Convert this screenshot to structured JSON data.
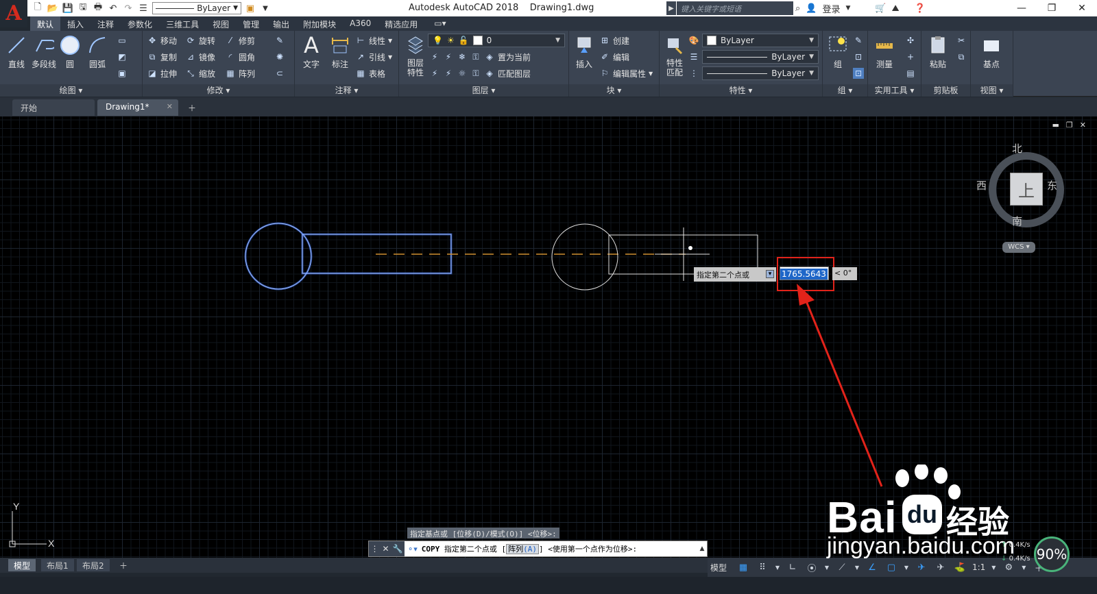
{
  "app": {
    "title": "Autodesk AutoCAD 2018",
    "document": "Drawing1.dwg",
    "logo_letter": "A"
  },
  "quick_access": {
    "layer_value": "ByLayer",
    "search_placeholder": "键入关键字或短语",
    "login_label": "登录"
  },
  "ribbon_tabs": [
    "默认",
    "插入",
    "注释",
    "参数化",
    "三维工具",
    "视图",
    "管理",
    "输出",
    "附加模块",
    "A360",
    "精选应用"
  ],
  "ribbon": {
    "draw": {
      "title": "绘图",
      "buttons": [
        "直线",
        "多段线",
        "圆",
        "圆弧"
      ]
    },
    "modify": {
      "title": "修改",
      "rows": [
        [
          "移动",
          "旋转",
          "修剪"
        ],
        [
          "复制",
          "镜像",
          "圆角"
        ],
        [
          "拉伸",
          "缩放",
          "阵列"
        ]
      ]
    },
    "annotation": {
      "title": "注释",
      "buttons": [
        "文字",
        "标注"
      ],
      "rows": [
        "线性",
        "引线",
        "表格"
      ]
    },
    "layers": {
      "title": "图层",
      "big_button": "图层\n特性",
      "layer_name": "0",
      "rows": [
        "置为当前",
        "匹配图层"
      ]
    },
    "block": {
      "title": "块",
      "big_button": "插入",
      "rows": [
        "创建",
        "编辑",
        "编辑属性"
      ]
    },
    "properties": {
      "title": "特性",
      "big_button": "特性\n匹配",
      "color": "ByLayer",
      "linetype": "ByLayer",
      "lineweight": "ByLayer"
    },
    "groups": {
      "title": "组",
      "big_button": "组"
    },
    "utilities": {
      "title": "实用工具",
      "big_button": "测量"
    },
    "clipboard": {
      "title": "剪贴板",
      "big_button": "粘贴"
    },
    "view": {
      "title": "视图",
      "big_button": "基点"
    }
  },
  "doc_tabs": [
    {
      "label": "开始",
      "active": false
    },
    {
      "label": "Drawing1*",
      "active": true
    }
  ],
  "viewcube": {
    "north": "北",
    "south": "南",
    "east": "东",
    "west": "西",
    "face": "上",
    "wcs": "WCS"
  },
  "dynamic_input": {
    "prompt": "指定第二个点或",
    "distance": "1765.5643",
    "angle": "< 0°"
  },
  "ucs": {
    "x": "X",
    "y": "Y"
  },
  "command": {
    "history": "指定基点或 [位移(D)/模式(O)] <位移>:",
    "name": "COPY",
    "prompt_pre": "指定第二个点或 [",
    "option": "阵列",
    "option_key": "(A)",
    "prompt_post": "] <使用第一个点作为位移>:"
  },
  "layout_tabs": [
    "模型",
    "布局1",
    "布局2"
  ],
  "status": {
    "model_label": "模型",
    "scale": "1:1"
  },
  "watermark": {
    "brand": "Bai",
    "brand_cn": "经验",
    "url": "jingyan.baidu.com"
  },
  "overlay": {
    "up_speed": "0.4K/s",
    "down_speed": "0.4K/s",
    "cpu": "90%"
  },
  "colors": {
    "canvas": "#000000",
    "selected_entity": "#4a7fe0",
    "rubber_band": "#c8902a",
    "highlight_box": "#e2231a"
  }
}
